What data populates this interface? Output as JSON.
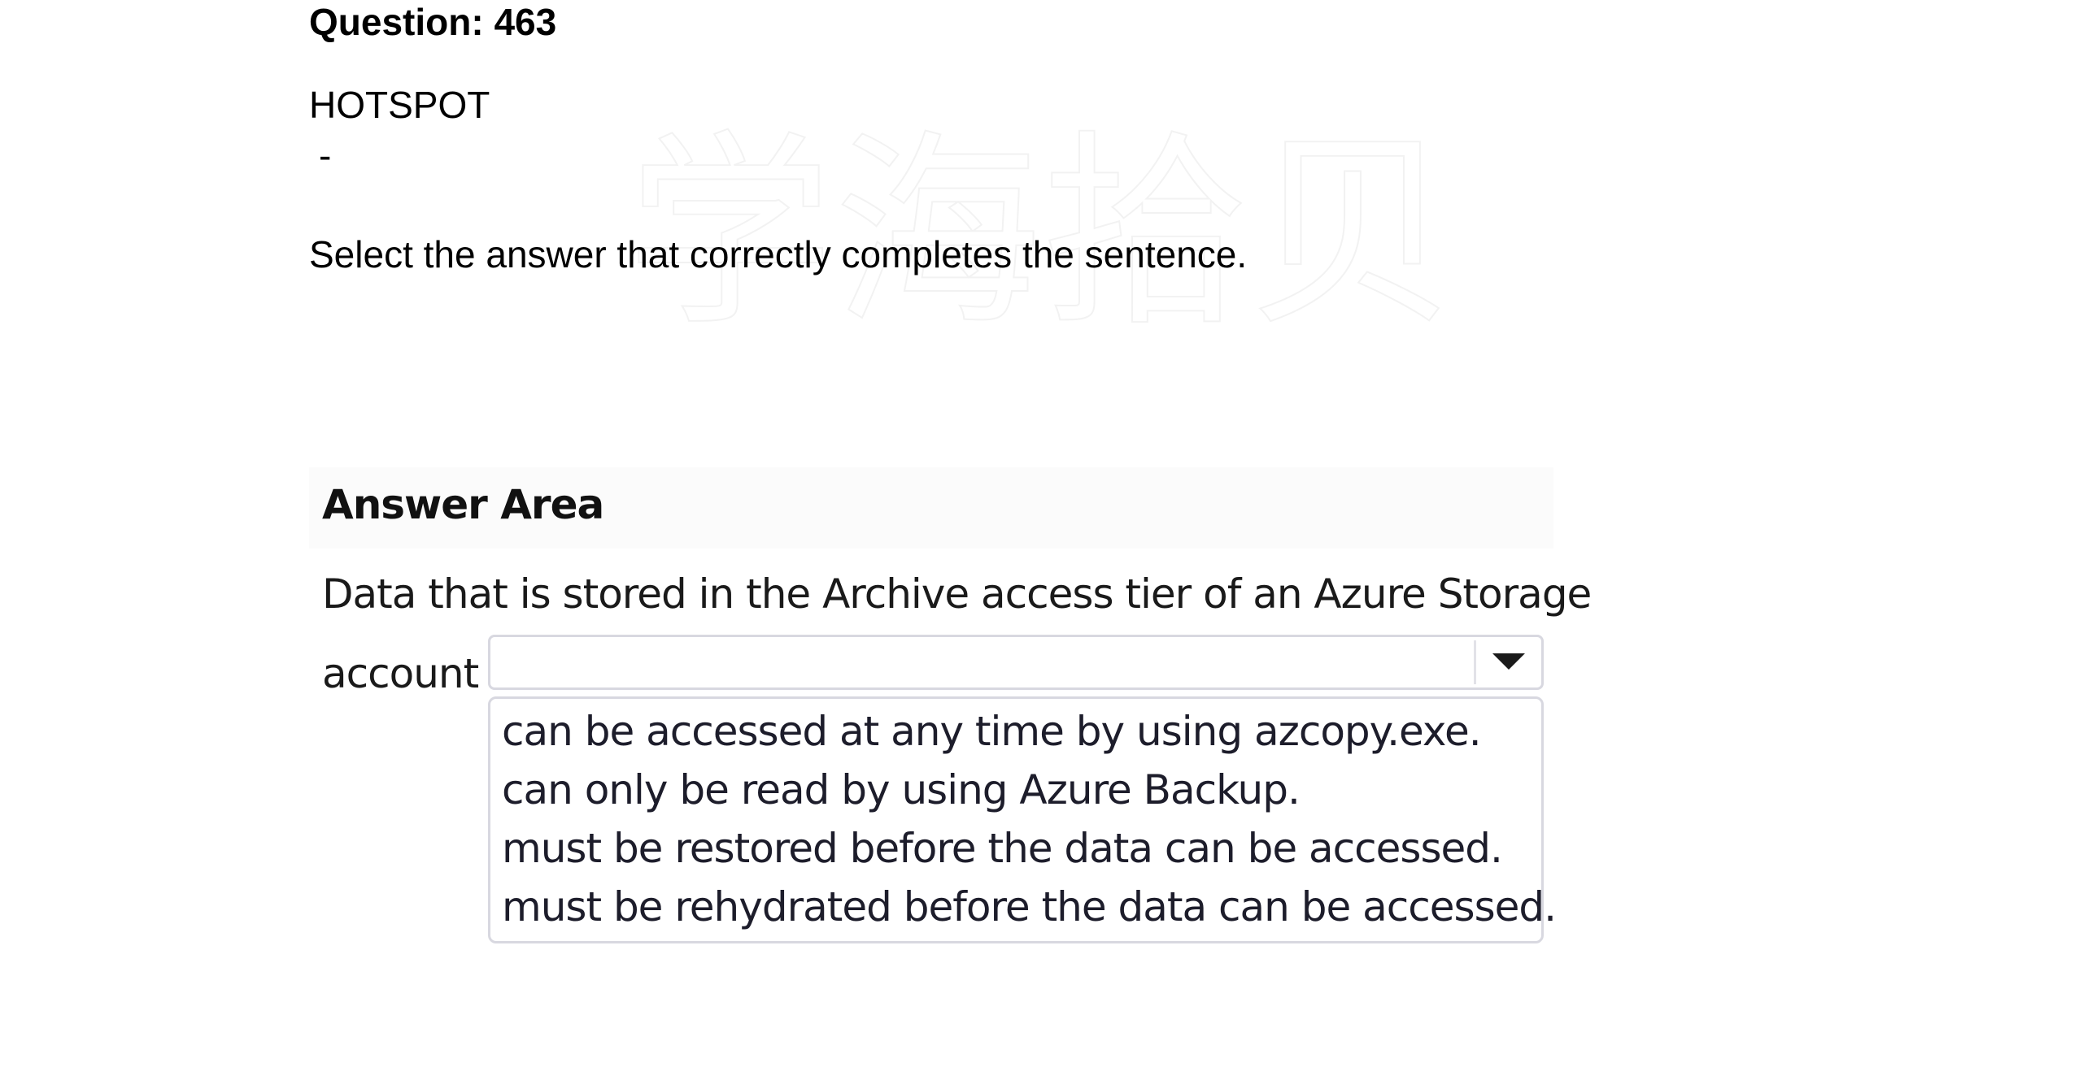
{
  "watermark": "学海拾贝",
  "question": {
    "title": "Question: 463",
    "type": "HOTSPOT",
    "separator": "-",
    "instruction": "Select the answer that correctly completes the sentence."
  },
  "answer_area": {
    "heading": "Answer Area",
    "sentence_part1": "Data that is stored in the Archive access tier of an Azure Storage",
    "sentence_part2": "account",
    "dropdown": {
      "selected": "",
      "icon": "chevron-down-icon",
      "options": [
        "can be accessed at any time by using azcopy.exe.",
        "can only be read by using Azure Backup.",
        "must be restored before the data can be accessed.",
        "must be rehydrated before the data can be accessed."
      ]
    }
  }
}
